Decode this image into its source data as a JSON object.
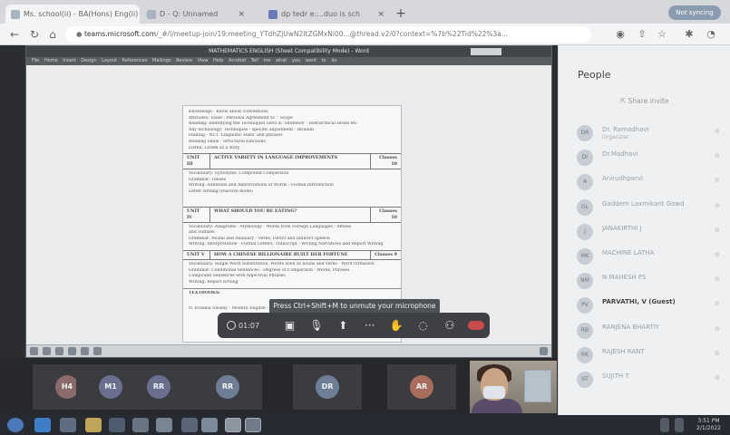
{
  "browser": {
    "tabs": [
      {
        "label": "Ms. school(ii) - BA(Hons) Eng(ii) - I"
      },
      {
        "label": "D - Q: Unnamed"
      },
      {
        "label": "dp  tedr e:...duo is sch"
      }
    ],
    "address": {
      "host": "teams.microsoft.com",
      "path": "/_#/l/meetup-join/19:meeting_YTdhZjUwN2ItZGMxNi00...@thread.v2/0?context=%7b%22Tid%22%3a..."
    },
    "profile": "Not syncing"
  },
  "meeting": {
    "word_title": "MATHEMATICS ENGLISH (Sheet Compatibility Mode) - Word",
    "word_menu": "File   Home   Insert   Design   Layout   References   Mailings   Review   View   Help   Acrobat   Tell me what you want to do",
    "toast": "Press Ctrl+Shift+M to unmute your microphone",
    "timer": "01:07",
    "doc_lines_top": [
      "Knowledge - Know about conventions",
      "Attitudes: Value - Personal Agreement to ‘‘ Scope",
      "Reading: Identifying the Techniques used in 'Sentence' - Hierarchical series etc",
      "          Any technology: Techniques - specific adjustment - Ibrahim",
      "          reading - NCT 'Linguistic Hans' and phrases",
      "          Reading Skills - Structural functions",
      "Listen: Lorem as a story"
    ],
    "unit3": {
      "unit": "UNIT III",
      "title": "ACTIVE VARIETY IN LANGUAGE IMPROVEMENTS",
      "classes": "Classes 10"
    },
    "doc_lines_mid": [
      "Vocabulary: Synonyms, Compound Comparison",
      "Grammar: Tenses",
      "Writing: Additions and Abbreviations of Words - Formal Introduction",
      "          Letter writing (reactive mode)"
    ],
    "unit4": {
      "unit": "UNIT IV",
      "title": "WHAT SHOULD YOU BE EATING?",
      "classes": "Classes 10"
    },
    "doc_lines_4": [
      "Vocabulary: Anagrams - etymology - Words from Foreign Languages - Affixes",
      "          and Suffixes",
      "Grammar: Modal and Auxiliary - Verbs, Direct and Indirect Speech",
      "Writing: Interpretation - Formal Letters, Transcript - Writing Narratives and Report Writing"
    ],
    "unit5": {
      "unit": "UNIT V",
      "title": "HOW A CHINESE BILLIONAIRE BUILT HER FORTUNE",
      "classes": "Classes 9"
    },
    "doc_lines_5": [
      "Vocabulary: Single Word Substitution, Words used as nouns and verbs - Word formation",
      "Grammar: Conditional Sentences - Degrees of Comparison - Words, Phrases",
      "          Compound Sentences with Adjectival Phrases",
      "Writing: Report writing"
    ],
    "textbook_label": "TEXTBOOKS:",
    "doc_tail": "N. Krishna Swamy - Modern English - A Book of grammar usage and composition - MC...",
    "participants": [
      {
        "initials": "H4",
        "color": "#8a6a6a"
      },
      {
        "initials": "M1",
        "color": "#6b6f8f"
      },
      {
        "initials": "RR",
        "color": "#6b6f8f"
      },
      {
        "initials": "RR",
        "color": "#6e7f95"
      },
      {
        "initials": "DR",
        "color": "#6e7f95"
      },
      {
        "initials": "AR",
        "color": "#a86d5c"
      }
    ]
  },
  "people_panel": {
    "title": "People",
    "share_invite": "Share invite",
    "rows": [
      {
        "initials": "DR",
        "name": "Dr. Ramadhavi",
        "sub": "Organizer",
        "bold": false
      },
      {
        "initials": "Dr",
        "name": "Dr.Madhavi",
        "sub": "",
        "bold": false
      },
      {
        "initials": "A",
        "name": "Anirudhparvi",
        "sub": "",
        "bold": false
      },
      {
        "initials": "GL",
        "name": "Gaddem Laxmikant Gowd",
        "sub": "",
        "bold": false
      },
      {
        "initials": "J",
        "name": "JANAKIRTHI J",
        "sub": "",
        "bold": false
      },
      {
        "initials": "MK",
        "name": "MACHINE LATHA",
        "sub": "",
        "bold": false
      },
      {
        "initials": "NM",
        "name": "N.MAHESH PS",
        "sub": "",
        "bold": false
      },
      {
        "initials": "PV",
        "name": "PARVATHI, V (Guest)",
        "sub": "",
        "bold": true
      },
      {
        "initials": "RB",
        "name": "RANJENA BHARTIY",
        "sub": "",
        "bold": false
      },
      {
        "initials": "RK",
        "name": "RAJESH RANT",
        "sub": "",
        "bold": false
      },
      {
        "initials": "ST",
        "name": "SUJITH T",
        "sub": "",
        "bold": false
      }
    ]
  },
  "taskbar": {
    "time": "3:51 PM",
    "date": "2/1/2022"
  }
}
